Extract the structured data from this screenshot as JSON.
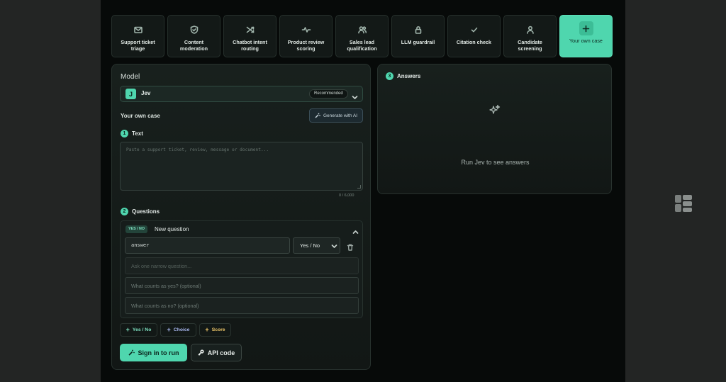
{
  "tabs": [
    {
      "label": "Support ticket triage",
      "icon": "mail-icon"
    },
    {
      "label": "Content moderation",
      "icon": "shield-icon"
    },
    {
      "label": "Chatbot intent routing",
      "icon": "shuffle-icon"
    },
    {
      "label": "Product review scoring",
      "icon": "activity-icon"
    },
    {
      "label": "Sales lead qualification",
      "icon": "users-icon"
    },
    {
      "label": "LLM guardrail",
      "icon": "lock-icon"
    },
    {
      "label": "Citation check",
      "icon": "check-icon"
    },
    {
      "label": "Candidate screening",
      "icon": "user-icon"
    },
    {
      "label": "Your own case",
      "icon": "plus-icon",
      "active": true
    }
  ],
  "model": {
    "label": "Model",
    "badge_letter": "J",
    "name": "Jev",
    "recommended": "Recommended"
  },
  "own_case": {
    "label": "Your own case",
    "generate_button": "Generate with AI"
  },
  "text_step": {
    "number": "1",
    "label": "Text",
    "placeholder": "Paste a support ticket, review, message or document...",
    "counter": "0 / 6,000"
  },
  "questions_step": {
    "number": "2",
    "label": "Questions",
    "question": {
      "type_badge": "YES / NO",
      "title": "New question",
      "answer_key": "answer",
      "type_value": "Yes / No",
      "question_placeholder": "Ask one narrow question...",
      "yes_placeholder": "What counts as yes? (optional)",
      "no_placeholder": "What counts as no? (optional)"
    },
    "add_buttons": [
      {
        "label": "Yes / No",
        "color": "#7fe3c2"
      },
      {
        "label": "Choice",
        "color": "#a9b8f0"
      },
      {
        "label": "Score",
        "color": "#f0c86a"
      }
    ]
  },
  "actions": {
    "signin": "Sign in to run",
    "api": "API code"
  },
  "answers": {
    "number": "3",
    "label": "Answers",
    "empty_message": "Run Jev to see answers"
  },
  "colors": {
    "accent": "#4fd6ae",
    "background": "#070a09"
  }
}
